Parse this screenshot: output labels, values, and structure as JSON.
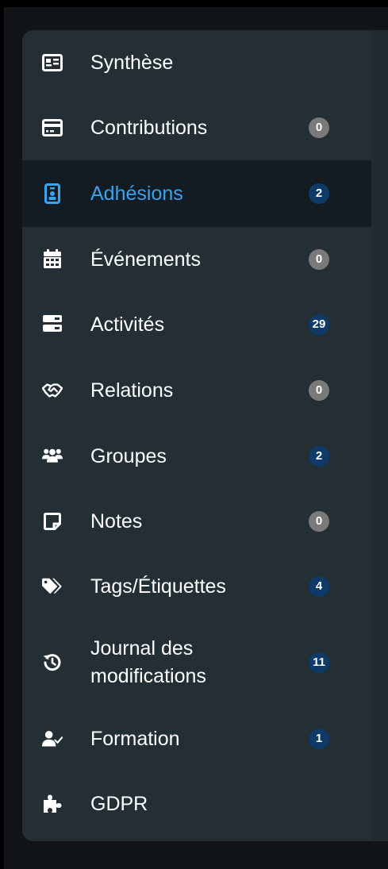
{
  "colors": {
    "page_bg": "#000000",
    "panel_bg": "#232f35",
    "active_bg": "#131c22",
    "active_text": "#3aa3f1",
    "badge_zero": "#7a7a7a",
    "badge_count": "#0d3a66"
  },
  "nav": {
    "items": [
      {
        "label": "Synthèse",
        "icon": "id-card-icon"
      },
      {
        "label": "Contributions",
        "icon": "credit-card-icon",
        "badge": "0"
      },
      {
        "label": "Adhésions",
        "icon": "id-badge-icon",
        "badge": "2",
        "active": true
      },
      {
        "label": "Événements",
        "icon": "calendar-icon",
        "badge": "0"
      },
      {
        "label": "Activités",
        "icon": "tasks-icon",
        "badge": "29"
      },
      {
        "label": "Relations",
        "icon": "handshake-icon",
        "badge": "0"
      },
      {
        "label": "Groupes",
        "icon": "users-icon",
        "badge": "2"
      },
      {
        "label": "Notes",
        "icon": "sticky-note-icon",
        "badge": "0"
      },
      {
        "label": "Tags/Étiquettes",
        "icon": "tags-icon",
        "badge": "4"
      },
      {
        "label_line1": "Journal des",
        "label_line2": "modifications",
        "icon": "history-icon",
        "badge": "11"
      },
      {
        "label": "Formation",
        "icon": "user-check-icon",
        "badge": "1"
      },
      {
        "label": "GDPR",
        "icon": "puzzle-icon"
      }
    ]
  }
}
